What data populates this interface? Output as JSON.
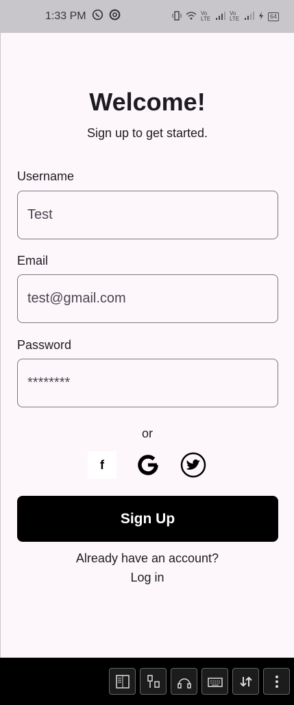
{
  "status_bar": {
    "time": "1:33 PM",
    "icons": [
      "whatsapp-icon",
      "sync-icon",
      "vibrate-icon",
      "wifi-icon",
      "volte-signal-icon",
      "volte-signal-icon",
      "battery-icon"
    ],
    "volte1": "Vo LTE",
    "volte2": "Vo LTE",
    "battery": "64"
  },
  "header": {
    "title": "Welcome!",
    "subtitle": "Sign up to get started."
  },
  "form": {
    "username_label": "Username",
    "username_value": "Test",
    "email_label": "Email",
    "email_value": "test@gmail.com",
    "password_label": "Password",
    "password_value": "********"
  },
  "social": {
    "or_text": "or",
    "facebook_letter": "f"
  },
  "signup_button": "Sign Up",
  "footer": {
    "account_text": "Already have an account?",
    "login_text": "Log in"
  },
  "colors": {
    "background": "#fdf7fc",
    "primary": "#000000",
    "border": "#79747e"
  }
}
